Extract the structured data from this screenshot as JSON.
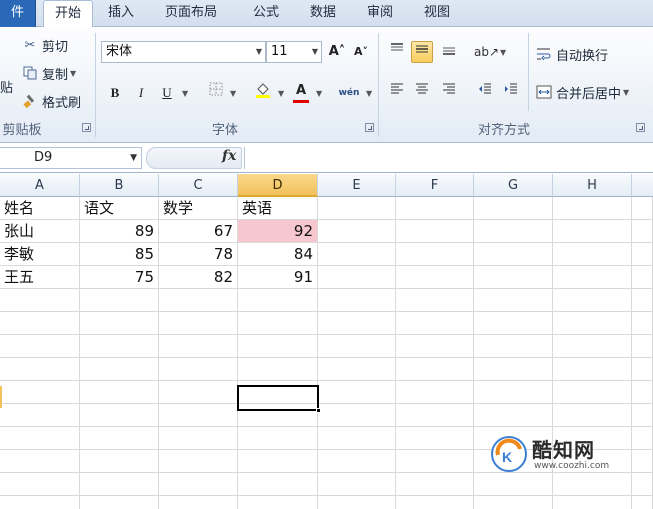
{
  "tabs": [
    {
      "label": "件",
      "key": "file"
    },
    {
      "label": "开始",
      "key": "home",
      "active": true
    },
    {
      "label": "插入",
      "key": "insert"
    },
    {
      "label": "页面布局",
      "key": "page_layout"
    },
    {
      "label": "公式",
      "key": "formulas"
    },
    {
      "label": "数据",
      "key": "data"
    },
    {
      "label": "审阅",
      "key": "review"
    },
    {
      "label": "视图",
      "key": "view"
    }
  ],
  "clipboard": {
    "paste_label": "贴",
    "cut_label": "剪切",
    "copy_label": "复制",
    "format_painter_label": "格式刷",
    "group_label": "剪贴板"
  },
  "font": {
    "family_value": "宋体",
    "size_value": "11",
    "grow_icon": "A˄",
    "shrink_icon": "A˅",
    "bold": "B",
    "italic": "I",
    "underline": "U",
    "font_color_glyph": "A",
    "phonetic_glyph": "wén",
    "group_label": "字体",
    "fill_color": "#ffff00",
    "font_color": "#e00000"
  },
  "alignment": {
    "wrap_text_label": "自动换行",
    "merge_center_label": "合并后居中",
    "group_label": "对齐方式"
  },
  "formula_bar": {
    "name_box": "D9",
    "fx_label": "fx",
    "formula_value": ""
  },
  "grid": {
    "columns": [
      "A",
      "B",
      "C",
      "D",
      "E",
      "F",
      "G",
      "H"
    ],
    "selected_column": "D",
    "rows": [
      [
        "姓名",
        "语文",
        "数学",
        "英语"
      ],
      [
        "张山",
        "89",
        "67",
        "92"
      ],
      [
        "李敏",
        "85",
        "78",
        "84"
      ],
      [
        "王五",
        "75",
        "82",
        "91"
      ]
    ],
    "highlight_color": "#f7c7cf"
  },
  "watermark": {
    "name": "酷知网",
    "url": "www.coozhi.com"
  }
}
